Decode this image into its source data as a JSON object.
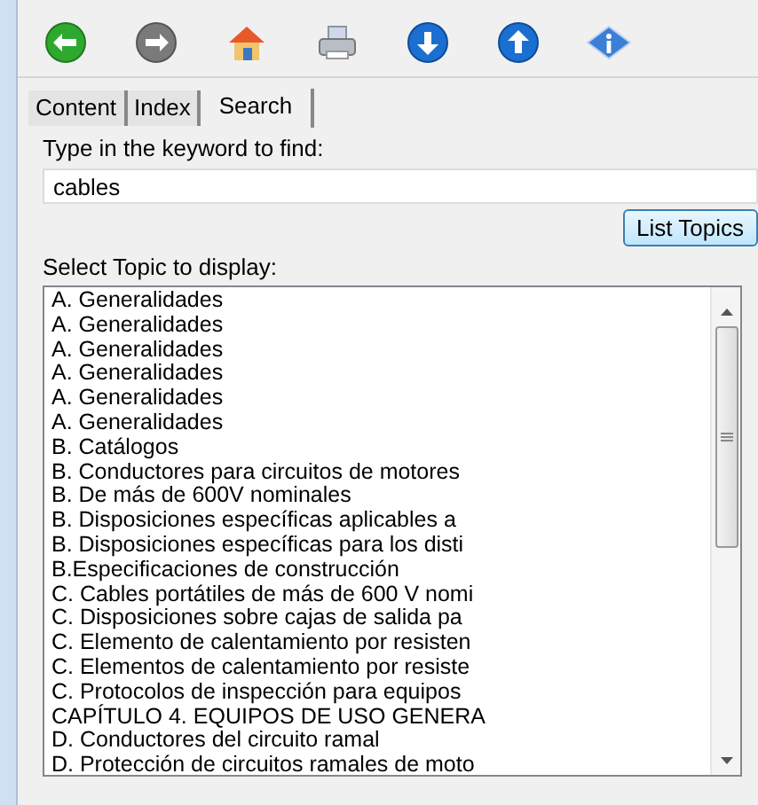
{
  "toolbar": [
    {
      "kind": "back"
    },
    {
      "kind": "forward"
    },
    {
      "kind": "home"
    },
    {
      "kind": "print"
    },
    {
      "kind": "down"
    },
    {
      "kind": "up"
    },
    {
      "kind": "info"
    }
  ],
  "tabs": [
    {
      "label": "Content",
      "selected": false
    },
    {
      "label": "Index",
      "selected": false
    },
    {
      "label": "Search",
      "selected": true
    }
  ],
  "keyword_label": "Type in the keyword to find:",
  "keyword": {
    "value": "cables"
  },
  "list_button": "List Topics",
  "topics_label": "Select Topic to display:",
  "topics": [
    "A. Generalidades",
    "A. Generalidades",
    "A. Generalidades",
    "A. Generalidades",
    "A. Generalidades",
    "A. Generalidades",
    "B. Catálogos",
    "B. Conductores para circuitos de motores",
    "B. De más de 600V nominales",
    "B. Disposiciones específicas aplicables a",
    "B. Disposiciones específicas para los disti",
    "B.Especificaciones de construcción",
    "C. Cables portátiles de más de 600 V nomi",
    "C. Disposiciones sobre cajas de salida pa",
    "C. Elemento de calentamiento por resisten",
    "C. Elementos de calentamiento por resiste",
    "C. Protocolos de inspección para equipos",
    "CAPÍTULO 4. EQUIPOS DE USO GENERA",
    "D. Conductores del circuito ramal",
    "D. Protección de circuitos ramales de moto"
  ]
}
